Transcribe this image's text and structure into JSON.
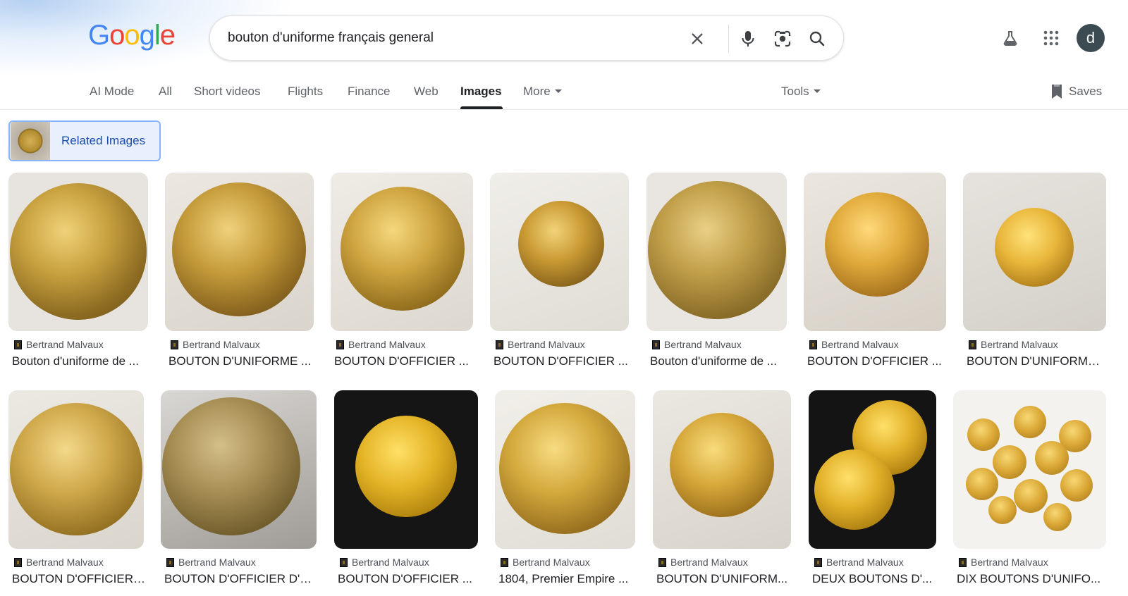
{
  "logo": {
    "text": "Google",
    "colors": [
      "#4285f4",
      "#ea4335",
      "#fbbc05",
      "#4285f4",
      "#34a853",
      "#ea4335"
    ]
  },
  "search": {
    "query": "bouton d'uniforme français general"
  },
  "icons": {
    "clear": "close-icon",
    "voice": "microphone-icon",
    "lens": "camera-lens-icon",
    "search": "search-icon",
    "labs": "flask-icon",
    "apps": "apps-grid-icon",
    "saves": "bookmark-icon"
  },
  "account": {
    "initial": "d"
  },
  "tabs": [
    {
      "label": "AI Mode"
    },
    {
      "label": "All"
    },
    {
      "label": "Short videos"
    },
    {
      "label": "Flights"
    },
    {
      "label": "Finance"
    },
    {
      "label": "Web"
    },
    {
      "label": "Images",
      "active": true
    },
    {
      "label": "More"
    }
  ],
  "tools": {
    "label": "Tools"
  },
  "saves": {
    "label": "Saves"
  },
  "related": {
    "label": "Related Images"
  },
  "results": [
    {
      "source": "Bertrand Malvaux",
      "title": "Bouton d'uniforme de ..."
    },
    {
      "source": "Bertrand Malvaux",
      "title": "BOUTON D'UNIFORME ..."
    },
    {
      "source": "Bertrand Malvaux",
      "title": "BOUTON D'OFFICIER ..."
    },
    {
      "source": "Bertrand Malvaux",
      "title": "BOUTON D'OFFICIER ..."
    },
    {
      "source": "Bertrand Malvaux",
      "title": "Bouton d'uniforme de ..."
    },
    {
      "source": "Bertrand Malvaux",
      "title": "BOUTON D'OFFICIER ..."
    },
    {
      "source": "Bertrand Malvaux",
      "title": "BOUTON D'UNIFORME..."
    },
    {
      "source": "Bertrand Malvaux",
      "title": "BOUTON D'OFFICIER ..."
    },
    {
      "source": "Bertrand Malvaux",
      "title": "BOUTON D'OFFICIER D'A..."
    },
    {
      "source": "Bertrand Malvaux",
      "title": "BOUTON D'OFFICIER ..."
    },
    {
      "source": "Bertrand Malvaux",
      "title": "1804, Premier Empire ..."
    },
    {
      "source": "Bertrand Malvaux",
      "title": "BOUTON D'UNIFORM..."
    },
    {
      "source": "Bertrand Malvaux",
      "title": "DEUX BOUTONS D'..."
    },
    {
      "source": "Bertrand Malvaux",
      "title": "DIX BOUTONS D'UNIFO..."
    }
  ]
}
